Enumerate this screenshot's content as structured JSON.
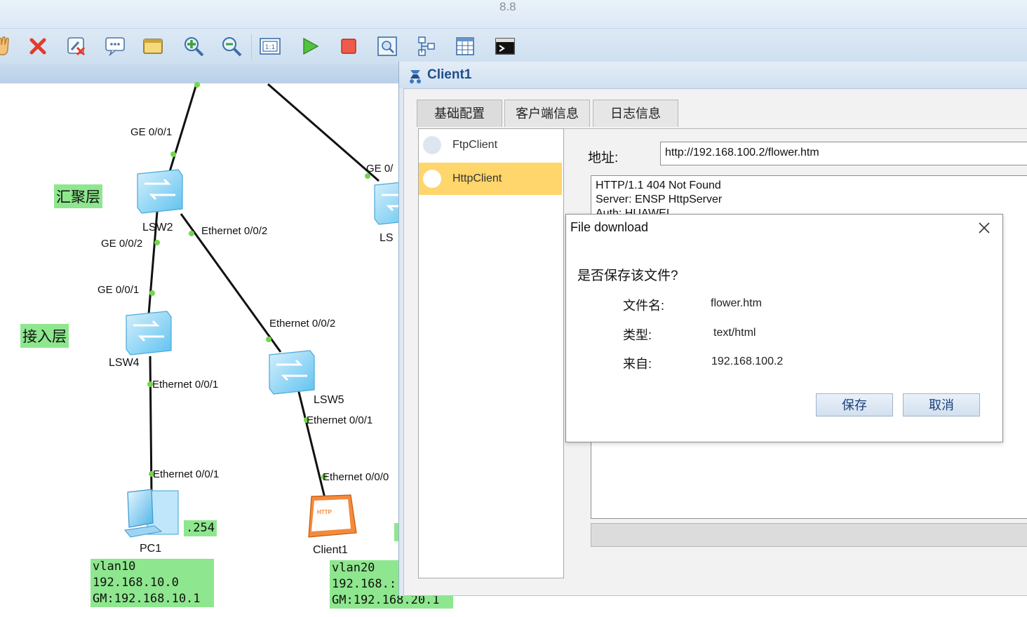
{
  "app": {
    "version": "8.8"
  },
  "toolbar": {
    "buttons": [
      "hand-tool-icon",
      "delete-icon",
      "delete-link-icon",
      "text-icon",
      "palette-icon",
      "zoom-in-icon",
      "zoom-out-icon",
      "fit-icon",
      "start-icon",
      "stop-icon",
      "capture-icon",
      "topology-icon",
      "grid-icon",
      "console-icon"
    ]
  },
  "topology": {
    "layer_labels": {
      "aggregation": "汇聚层",
      "access": "接入层"
    },
    "devices": {
      "lsw2": "LSW2",
      "lsw4": "LSW4",
      "lsw5": "LSW5",
      "partial_lsw": "LS",
      "pc1": "PC1",
      "client1": "Client1"
    },
    "ports": {
      "lsw2_top": "GE 0/0/1",
      "right_top": "GE 0/",
      "lsw2_down": "GE 0/0/2",
      "lsw2_eth": "Ethernet 0/0/2",
      "lsw4_up": "GE 0/0/1",
      "lsw5_up": "Ethernet 0/0/2",
      "lsw4_down": "Ethernet 0/0/1",
      "lsw5_down": "Ethernet 0/0/1",
      "pc1_port": "Ethernet 0/0/1",
      "client1_port": "Ethernet 0/0/0"
    },
    "pc1_ip_suffix": ".254",
    "http_tag": "HTTP",
    "vlan10": {
      "line1": "vlan10",
      "line2": "192.168.10.0",
      "line3": "GM:192.168.10.1"
    },
    "vlan20": {
      "line1": "vlan20",
      "line2": "192.168.:",
      "line3": "GM:192.168.20.1"
    }
  },
  "client_window": {
    "title": "Client1",
    "tabs": [
      "基础配置",
      "客户端信息",
      "日志信息"
    ],
    "list": [
      {
        "label": "FtpClient"
      },
      {
        "label": "HttpClient"
      }
    ],
    "address_label": "地址:",
    "address_value": "http://192.168.100.2/flower.htm",
    "response_text": "HTTP/1.1 404 Not Found\nServer: ENSP HttpServer\nAuth: HUAWEI"
  },
  "dialog": {
    "title": "File download",
    "question": "是否保存该文件?",
    "rows": [
      {
        "label": "文件名:",
        "value": "flower.htm"
      },
      {
        "label": "类型:",
        "value": "text/html"
      },
      {
        "label": "来自:",
        "value": "192.168.100.2"
      }
    ],
    "save_label": "保存",
    "cancel_label": "取消"
  },
  "colors": {
    "accent": "#1f4e8a",
    "highlight": "#ffd66b",
    "label_bg": "#8ee78e",
    "port_dot": "#74d64b"
  }
}
